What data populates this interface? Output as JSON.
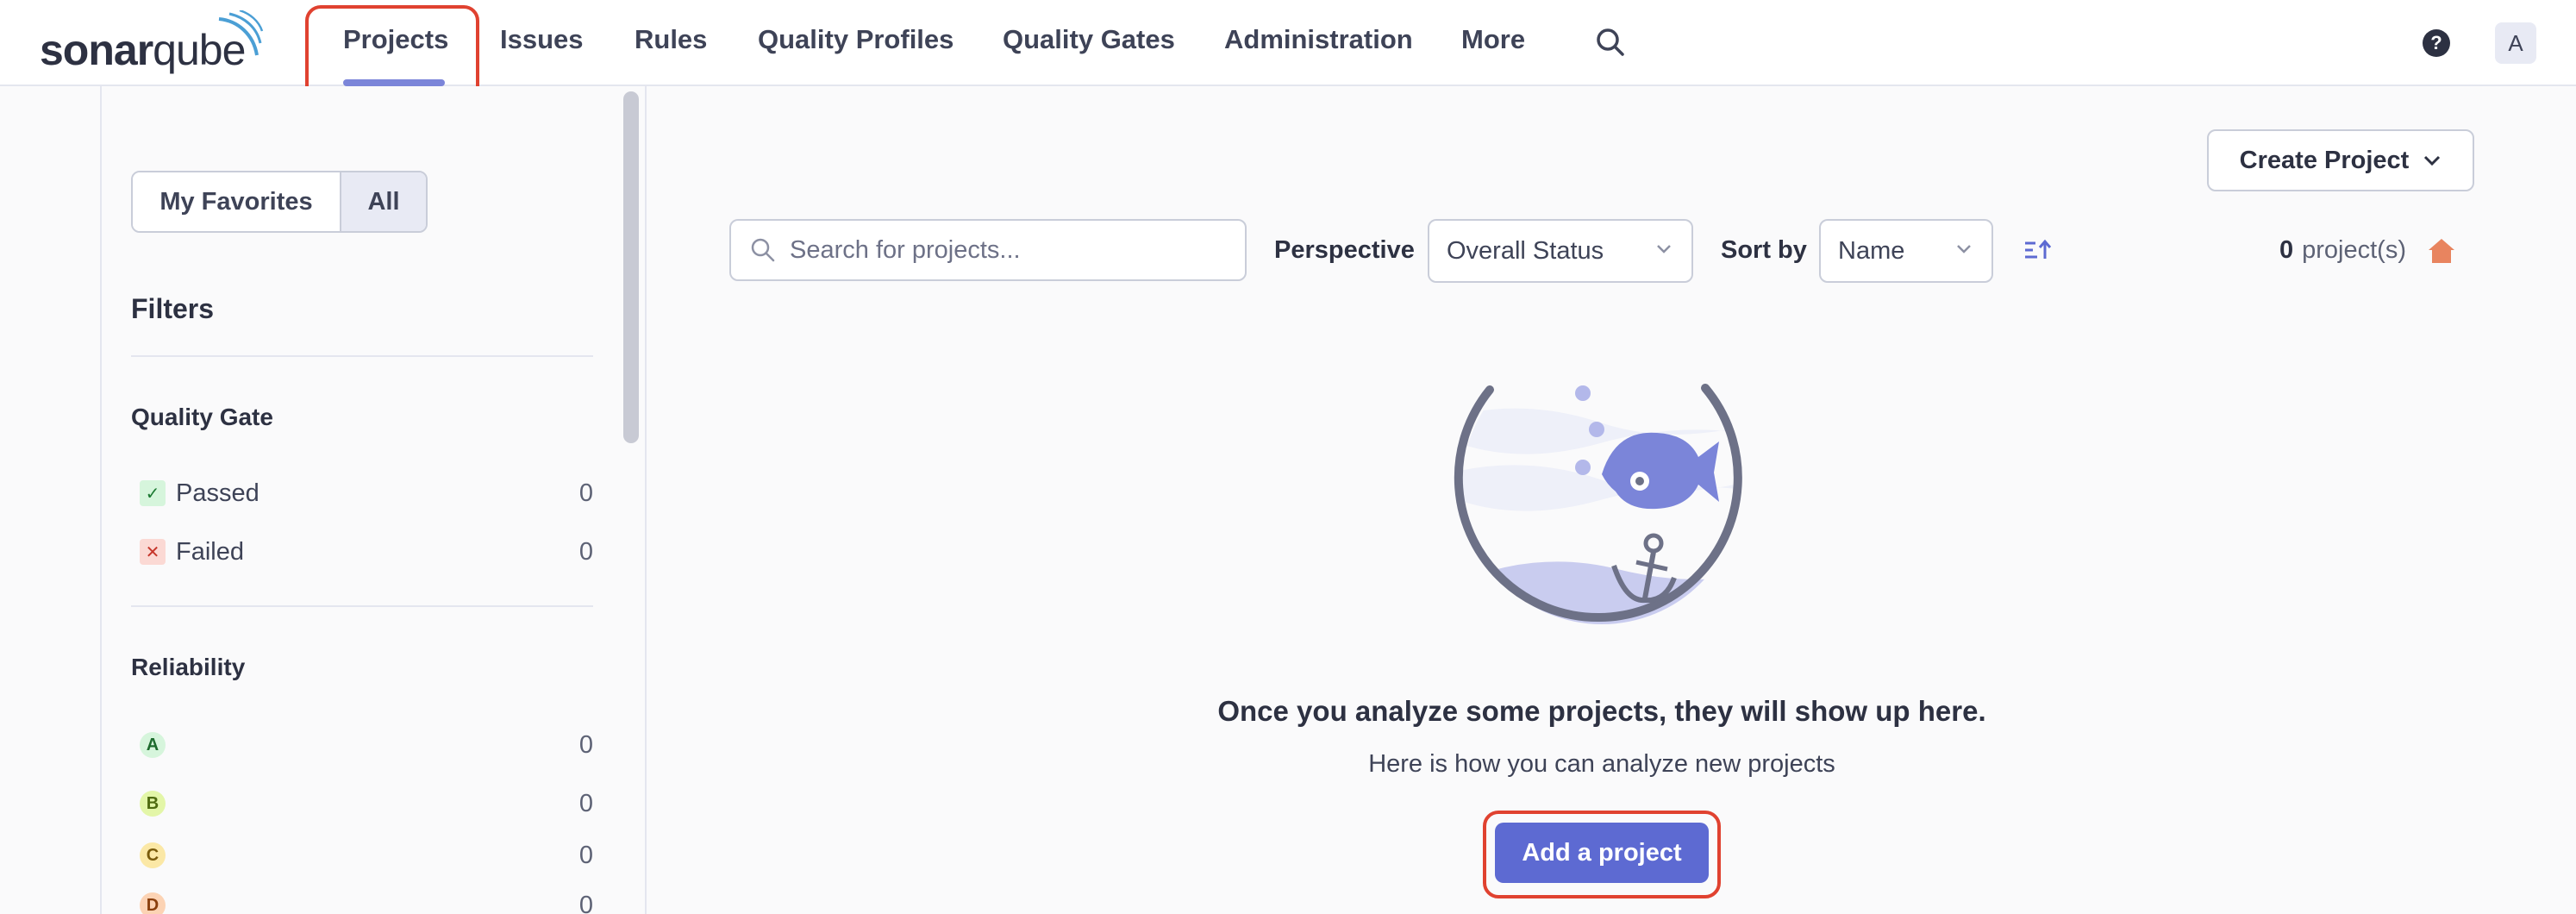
{
  "header": {
    "logo_text_bold": "sonar",
    "logo_text_light": "qube",
    "nav": [
      {
        "label": "Projects",
        "active": true
      },
      {
        "label": "Issues"
      },
      {
        "label": "Rules"
      },
      {
        "label": "Quality Profiles"
      },
      {
        "label": "Quality Gates"
      },
      {
        "label": "Administration"
      },
      {
        "label": "More"
      }
    ],
    "search_icon": "search-icon",
    "help_icon": "help-icon",
    "avatar_letter": "A"
  },
  "sidebar": {
    "favorites_label": "My Favorites",
    "all_label": "All",
    "filters_title": "Filters",
    "quality_gate": {
      "title": "Quality Gate",
      "items": [
        {
          "label": "Passed",
          "count": "0",
          "icon": "check-icon"
        },
        {
          "label": "Failed",
          "count": "0",
          "icon": "x-icon"
        }
      ]
    },
    "reliability": {
      "title": "Reliability",
      "items": [
        {
          "rating": "A",
          "count": "0"
        },
        {
          "rating": "B",
          "count": "0"
        },
        {
          "rating": "C",
          "count": "0"
        },
        {
          "rating": "D",
          "count": "0"
        }
      ]
    }
  },
  "main": {
    "create_project_label": "Create Project",
    "search_placeholder": "Search for projects...",
    "perspective_label": "Perspective",
    "perspective_value": "Overall Status",
    "sort_label": "Sort by",
    "sort_value": "Name",
    "project_count": "0",
    "project_count_suffix": "project(s)",
    "empty_title": "Once you analyze some projects, they will show up here.",
    "empty_subtitle": "Here is how you can analyze new projects",
    "add_project_label": "Add a project"
  },
  "colors": {
    "accent": "#5d6ad2",
    "highlight": "#e04230",
    "home_icon": "#e8845f"
  }
}
